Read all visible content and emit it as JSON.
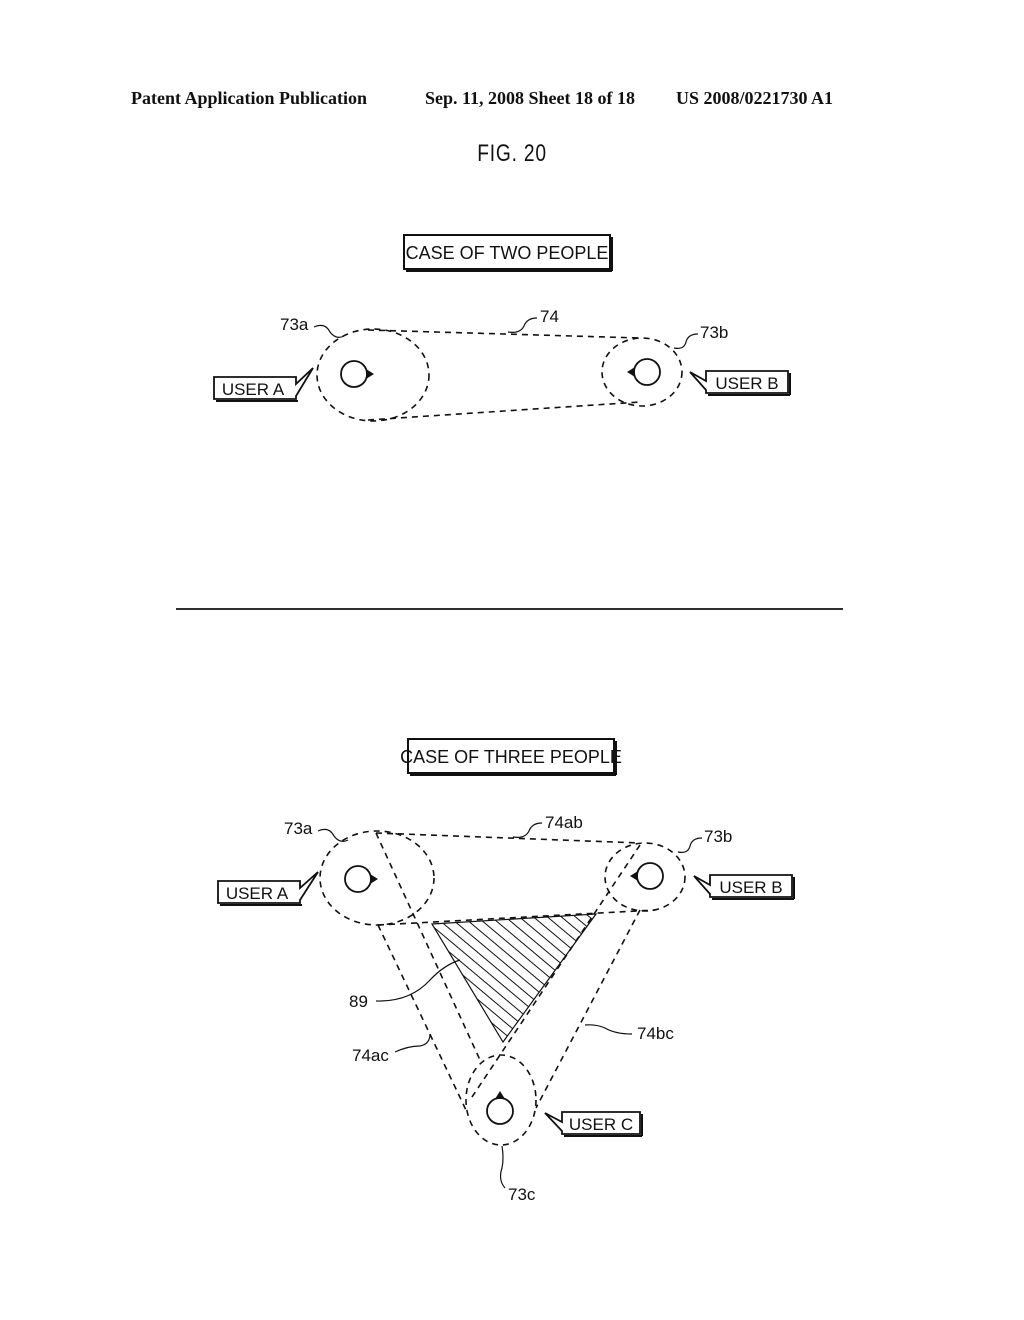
{
  "header": {
    "left": "Patent Application Publication",
    "middle": "Sep. 11, 2008  Sheet 18 of 18",
    "right": "US 2008/0221730 A1"
  },
  "figure": {
    "title": "FIG. 20"
  },
  "two_people": {
    "case_label": "CASE OF TWO PEOPLE",
    "users": [
      {
        "label": "USER A",
        "area_ref": "73a"
      },
      {
        "label": "USER B",
        "area_ref": "73b"
      }
    ],
    "link_ref": "74"
  },
  "three_people": {
    "case_label": "CASE OF THREE PEOPLE",
    "users": [
      {
        "label": "USER A",
        "area_ref": "73a"
      },
      {
        "label": "USER B",
        "area_ref": "73b"
      },
      {
        "label": "USER C",
        "area_ref": "73c"
      }
    ],
    "link_refs": {
      "ab": "74ab",
      "ac": "74ac",
      "bc": "74bc"
    },
    "overlap_ref": "89"
  }
}
